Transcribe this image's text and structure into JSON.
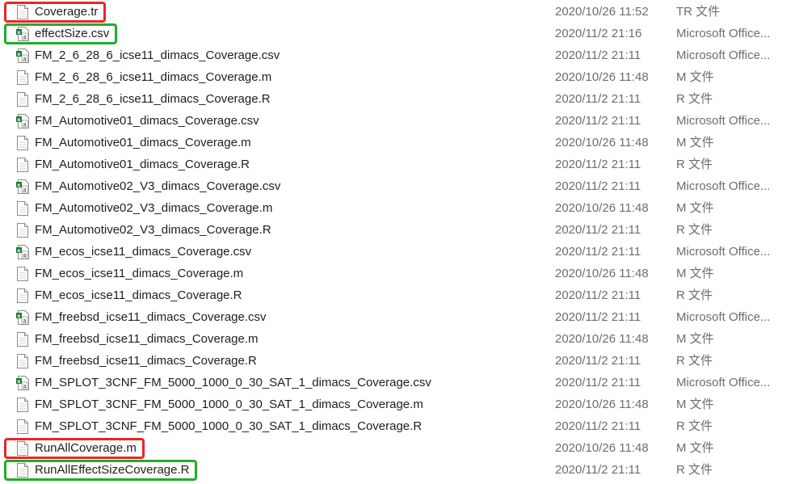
{
  "colors": {
    "highlight_red": "#e8262a",
    "highlight_green": "#1fae2a",
    "text": "#1e1e1e",
    "muted_text": "#6d6d6d",
    "excel_green": "#1d7a3c"
  },
  "files": [
    {
      "name": "Coverage.tr",
      "date": "2020/10/26 11:52",
      "type": "TR 文件",
      "icon": "document-icon",
      "highlight": "red"
    },
    {
      "name": "effectSize.csv",
      "date": "2020/11/2 21:16",
      "type": "Microsoft Office...",
      "icon": "csv-excel-icon",
      "highlight": "green"
    },
    {
      "name": "FM_2_6_28_6_icse11_dimacs_Coverage.csv",
      "date": "2020/11/2 21:11",
      "type": "Microsoft Office...",
      "icon": "csv-excel-icon",
      "highlight": ""
    },
    {
      "name": "FM_2_6_28_6_icse11_dimacs_Coverage.m",
      "date": "2020/10/26 11:48",
      "type": "M 文件",
      "icon": "document-icon",
      "highlight": ""
    },
    {
      "name": "FM_2_6_28_6_icse11_dimacs_Coverage.R",
      "date": "2020/11/2 21:11",
      "type": "R 文件",
      "icon": "document-icon",
      "highlight": ""
    },
    {
      "name": "FM_Automotive01_dimacs_Coverage.csv",
      "date": "2020/11/2 21:11",
      "type": "Microsoft Office...",
      "icon": "csv-excel-icon",
      "highlight": ""
    },
    {
      "name": "FM_Automotive01_dimacs_Coverage.m",
      "date": "2020/10/26 11:48",
      "type": "M 文件",
      "icon": "document-icon",
      "highlight": ""
    },
    {
      "name": "FM_Automotive01_dimacs_Coverage.R",
      "date": "2020/11/2 21:11",
      "type": "R 文件",
      "icon": "document-icon",
      "highlight": ""
    },
    {
      "name": "FM_Automotive02_V3_dimacs_Coverage.csv",
      "date": "2020/11/2 21:11",
      "type": "Microsoft Office...",
      "icon": "csv-excel-icon",
      "highlight": ""
    },
    {
      "name": "FM_Automotive02_V3_dimacs_Coverage.m",
      "date": "2020/10/26 11:48",
      "type": "M 文件",
      "icon": "document-icon",
      "highlight": ""
    },
    {
      "name": "FM_Automotive02_V3_dimacs_Coverage.R",
      "date": "2020/11/2 21:11",
      "type": "R 文件",
      "icon": "document-icon",
      "highlight": ""
    },
    {
      "name": "FM_ecos_icse11_dimacs_Coverage.csv",
      "date": "2020/11/2 21:11",
      "type": "Microsoft Office...",
      "icon": "csv-excel-icon",
      "highlight": ""
    },
    {
      "name": "FM_ecos_icse11_dimacs_Coverage.m",
      "date": "2020/10/26 11:48",
      "type": "M 文件",
      "icon": "document-icon",
      "highlight": ""
    },
    {
      "name": "FM_ecos_icse11_dimacs_Coverage.R",
      "date": "2020/11/2 21:11",
      "type": "R 文件",
      "icon": "document-icon",
      "highlight": ""
    },
    {
      "name": "FM_freebsd_icse11_dimacs_Coverage.csv",
      "date": "2020/11/2 21:11",
      "type": "Microsoft Office...",
      "icon": "csv-excel-icon",
      "highlight": ""
    },
    {
      "name": "FM_freebsd_icse11_dimacs_Coverage.m",
      "date": "2020/10/26 11:48",
      "type": "M 文件",
      "icon": "document-icon",
      "highlight": ""
    },
    {
      "name": "FM_freebsd_icse11_dimacs_Coverage.R",
      "date": "2020/11/2 21:11",
      "type": "R 文件",
      "icon": "document-icon",
      "highlight": ""
    },
    {
      "name": "FM_SPLOT_3CNF_FM_5000_1000_0_30_SAT_1_dimacs_Coverage.csv",
      "date": "2020/11/2 21:11",
      "type": "Microsoft Office...",
      "icon": "csv-excel-icon",
      "highlight": ""
    },
    {
      "name": "FM_SPLOT_3CNF_FM_5000_1000_0_30_SAT_1_dimacs_Coverage.m",
      "date": "2020/10/26 11:48",
      "type": "M 文件",
      "icon": "document-icon",
      "highlight": ""
    },
    {
      "name": "FM_SPLOT_3CNF_FM_5000_1000_0_30_SAT_1_dimacs_Coverage.R",
      "date": "2020/11/2 21:11",
      "type": "R 文件",
      "icon": "document-icon",
      "highlight": ""
    },
    {
      "name": "RunAllCoverage.m",
      "date": "2020/10/26 11:48",
      "type": "M 文件",
      "icon": "document-icon",
      "highlight": "red"
    },
    {
      "name": "RunAllEffectSizeCoverage.R",
      "date": "2020/11/2 21:11",
      "type": "R 文件",
      "icon": "document-icon",
      "highlight": "green"
    }
  ]
}
